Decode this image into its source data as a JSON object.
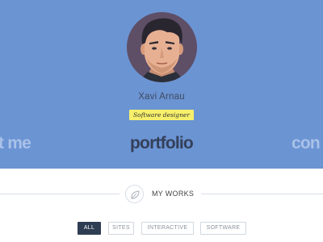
{
  "theme": {
    "hero_bg": "#6b94d3",
    "name_color": "#3f4a60",
    "badge_bg": "#f6ef6b",
    "nav_active_color": "#34405a",
    "nav_muted_color": "#a9c1e9",
    "rule_color": "#d8dee6",
    "filter_active_bg": "#2f3d52",
    "filter_active_text": "#ffffff",
    "filter_border": "#d3d8de",
    "filter_text": "#8a929b",
    "leaf_icon_color": "#b6bcc4"
  },
  "profile": {
    "name": "Xavi Arnau",
    "role": "Software designer",
    "avatar_icon": "illustrated-portrait-avatar"
  },
  "nav": {
    "about_label": "ut me",
    "portfolio_label": "portfolio",
    "contact_label": "con"
  },
  "section": {
    "icon": "leaf-icon",
    "title": "MY WORKS"
  },
  "filters": {
    "all": "ALL",
    "sites": "SITES",
    "interactive": "INTERACTIVE",
    "software": "SOFTWARE",
    "active": "all"
  }
}
